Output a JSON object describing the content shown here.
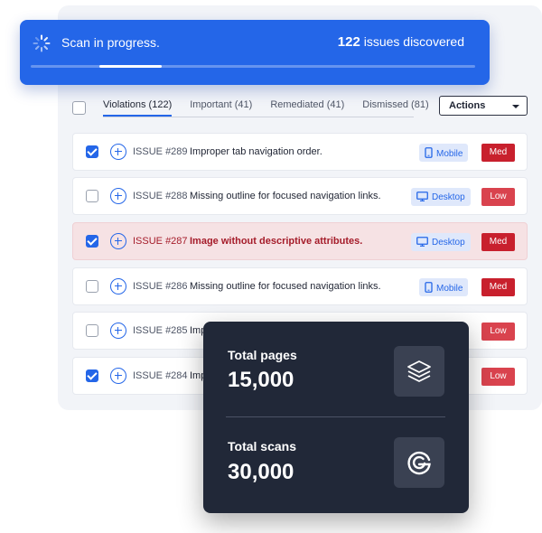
{
  "scan": {
    "status": "Scan in progress.",
    "count": "122",
    "count_suffix": " issues discovered",
    "progress_percent": 14
  },
  "tabs": [
    {
      "label": "Violations (122)",
      "active": true
    },
    {
      "label": "Important (41)",
      "active": false
    },
    {
      "label": "Remediated (41)",
      "active": false
    },
    {
      "label": "Dismissed (81)",
      "active": false
    }
  ],
  "actions": {
    "label": "Actions"
  },
  "issues": [
    {
      "id": "ISSUE #289",
      "title": "Improper tab navigation order.",
      "device": "Mobile",
      "device_icon": "mobile-icon",
      "severity": "Med",
      "checked": true,
      "highlighted": false
    },
    {
      "id": "ISSUE #288",
      "title": "Missing outline for focused navigation links.",
      "device": "Desktop",
      "device_icon": "desktop-icon",
      "severity": "Low",
      "checked": false,
      "highlighted": false
    },
    {
      "id": "ISSUE #287",
      "title": "Image without descriptive attributes.",
      "device": "Desktop",
      "device_icon": "desktop-icon",
      "severity": "Med",
      "checked": true,
      "highlighted": true
    },
    {
      "id": "ISSUE #286",
      "title": "Missing outline for focused navigation links.",
      "device": "Mobile",
      "device_icon": "mobile-icon",
      "severity": "Med",
      "checked": false,
      "highlighted": false
    },
    {
      "id": "ISSUE #285",
      "title": "Imp",
      "device": "",
      "device_icon": "",
      "severity": "Low",
      "checked": false,
      "highlighted": false
    },
    {
      "id": "ISSUE #284",
      "title": "Imp",
      "device": "",
      "device_icon": "",
      "severity": "Low",
      "checked": true,
      "highlighted": false
    }
  ],
  "stats": {
    "pages_label": "Total pages",
    "pages_value": "15,000",
    "pages_icon": "layers-icon",
    "scans_label": "Total scans",
    "scans_value": "30,000",
    "scans_icon": "brand-g-icon"
  },
  "colors": {
    "accent": "#2466e8",
    "card_dark": "#212838",
    "severity_med": "#c8202d",
    "severity_low": "#d9434e",
    "highlight_row": "#f6e2e4"
  }
}
